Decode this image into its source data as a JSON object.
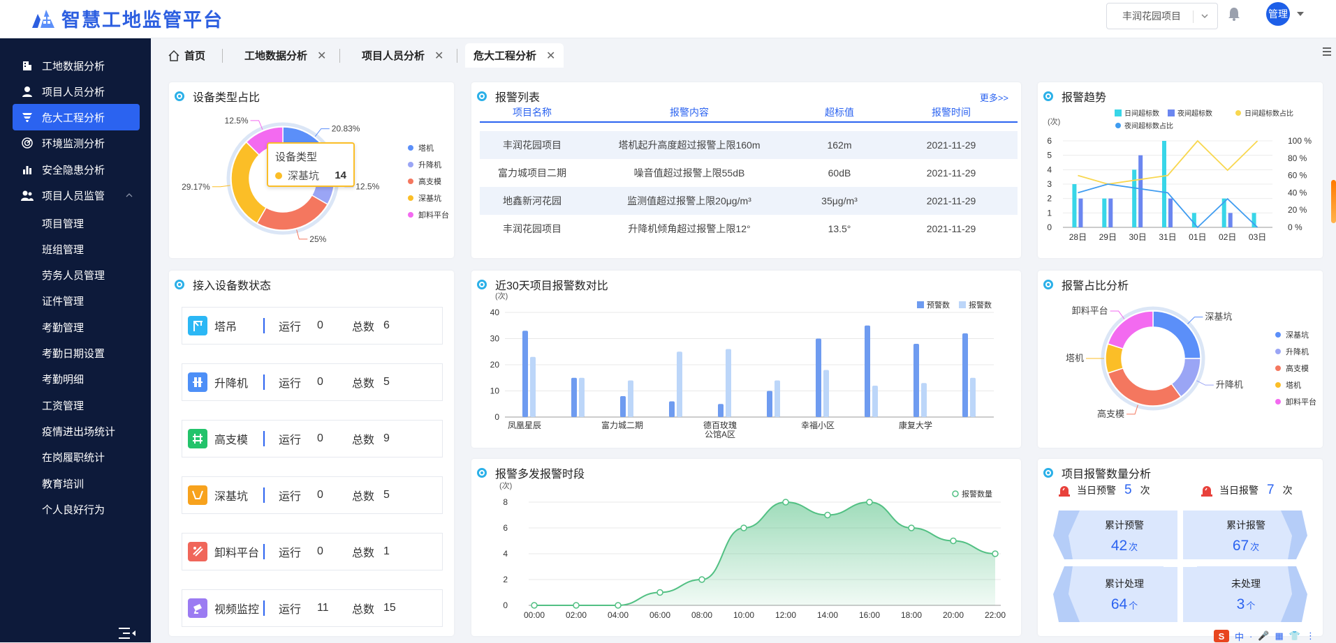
{
  "app": {
    "title": "智慧工地监管平台",
    "project_select": "丰润花园项目",
    "user_avatar": "管理"
  },
  "colors": {
    "accent": "#2b63f0",
    "sidebar_bg": "#0d1a3a",
    "teal": "#2bb0e8"
  },
  "sidebar": {
    "items": [
      {
        "label": "工地数据分析",
        "icon": "building-icon"
      },
      {
        "label": "项目人员分析",
        "icon": "user-icon"
      },
      {
        "label": "危大工程分析",
        "icon": "filter-icon",
        "active": true
      },
      {
        "label": "环境监测分析",
        "icon": "radar-icon"
      },
      {
        "label": "安全隐患分析",
        "icon": "bar-chart-icon"
      },
      {
        "label": "项目人员监管",
        "icon": "users-icon",
        "expanded": true
      }
    ],
    "sub_items": [
      "项目管理",
      "班组管理",
      "劳务人员管理",
      "证件管理",
      "考勤管理",
      "考勤日期设置",
      "考勤明细",
      "工资管理",
      "疫情进出场统计",
      "在岗履职统计",
      "教育培训",
      "个人良好行为"
    ]
  },
  "tabs": [
    {
      "label": "首页",
      "icon": "home-icon"
    },
    {
      "label": "工地数据分析",
      "closable": true
    },
    {
      "label": "项目人员分析",
      "closable": true
    },
    {
      "label": "危大工程分析",
      "closable": true,
      "active": true
    }
  ],
  "device_type": {
    "title": "设备类型占比",
    "tooltip": {
      "title": "设备类型",
      "name": "深基坑",
      "value": "14"
    },
    "labels": [
      "20.83%",
      "12.5%",
      "25%",
      "29.17%",
      "12.5%"
    ],
    "chart_data": {
      "type": "pie",
      "title": "设备类型占比",
      "slices": [
        {
          "name": "塔机",
          "value": 20.83,
          "color": "#5b8ff9"
        },
        {
          "name": "升降机",
          "value": 12.5,
          "color": "#9aa5f5"
        },
        {
          "name": "高支模",
          "value": 25,
          "color": "#f4775f"
        },
        {
          "name": "深基坑",
          "value": 29.17,
          "color": "#fbbe27"
        },
        {
          "name": "卸料平台",
          "value": 12.5,
          "color": "#f36af0"
        }
      ]
    }
  },
  "device_status": {
    "title": "接入设备数状态",
    "run_label": "运行",
    "total_label": "总数",
    "rows": [
      {
        "name": "塔吊",
        "run": "0",
        "total": "6",
        "icon": "crane-icon",
        "color": "#2bb7f5"
      },
      {
        "name": "升降机",
        "run": "0",
        "total": "5",
        "icon": "elevator-icon",
        "color": "#4d8ff7"
      },
      {
        "name": "高支模",
        "run": "0",
        "total": "9",
        "icon": "scaffold-icon",
        "color": "#23c36b"
      },
      {
        "name": "深基坑",
        "run": "0",
        "total": "5",
        "icon": "pit-icon",
        "color": "#f7a21d"
      },
      {
        "name": "卸料平台",
        "run": "0",
        "total": "1",
        "icon": "platform-icon",
        "color": "#f0665a"
      },
      {
        "name": "视频监控",
        "run": "11",
        "total": "15",
        "icon": "camera-icon",
        "color": "#9b7bf2"
      }
    ]
  },
  "alarm_list": {
    "title": "报警列表",
    "more": "更多>>",
    "headers": [
      "项目名称",
      "报警内容",
      "超标值",
      "报警时间"
    ],
    "rows": [
      [
        "丰润花园项目",
        "塔机起升高度超过报警上限160m",
        "162m",
        "2021-11-29"
      ],
      [
        "富力城项目二期",
        "噪音值超过报警上限55dB",
        "60dB",
        "2021-11-29"
      ],
      [
        "地鑫新河花园",
        "监测值超过报警上限20μg/m³",
        "35μg/m³",
        "2021-11-29"
      ],
      [
        "丰润花园项目",
        "升降机倾角超过报警上限12°",
        "13.5°",
        "2021-11-29"
      ]
    ]
  },
  "alarm_trend": {
    "title": "报警趋势",
    "unit": "(次)",
    "chart_data": {
      "type": "bar",
      "title": "报警趋势",
      "categories": [
        "28日",
        "29日",
        "30日",
        "31日",
        "01日",
        "02日",
        "03日"
      ],
      "ylim": [
        0,
        6
      ],
      "y2lim": [
        0,
        100
      ],
      "yticks": [
        "6",
        "5",
        "4",
        "3",
        "2",
        "1",
        "0"
      ],
      "y2ticks": [
        "100 %",
        "80 %",
        "60 %",
        "40 %",
        "20 %",
        "0 %"
      ],
      "legend": [
        "日间超标数",
        "夜间超标数",
        "日间超标数占比",
        "夜间超标数占比"
      ],
      "series": [
        {
          "name": "日间超标数",
          "values": [
            3,
            2,
            4,
            6,
            1,
            2,
            1
          ],
          "color": "#38d6e8"
        },
        {
          "name": "夜间超标数",
          "values": [
            2,
            2,
            5,
            2,
            0,
            1,
            0
          ],
          "color": "#6b86f0"
        },
        {
          "name": "日间超标数占比",
          "values": [
            60,
            50,
            55,
            60,
            100,
            66,
            100
          ],
          "color": "#f8d74f",
          "axis": "right"
        },
        {
          "name": "夜间超标数占比",
          "values": [
            40,
            50,
            45,
            40,
            0,
            33,
            0
          ],
          "color": "#3f9cf0",
          "axis": "right"
        }
      ]
    }
  },
  "compare30": {
    "title": "近30天项目报警数对比",
    "unit": "(次)",
    "chart_data": {
      "type": "bar",
      "title": "近30天项目报警数对比",
      "categories": [
        "凤凰星辰",
        "",
        "富力城二期",
        "",
        "德百玫瑰公馆A区",
        "",
        "幸福小区",
        "",
        "康复大学",
        ""
      ],
      "category_labels": [
        "凤凰星辰",
        "富力城二期",
        "德百玫瑰公馆A区",
        "幸福小区",
        "康复大学"
      ],
      "ylim": [
        0,
        40
      ],
      "yticks": [
        "40",
        "30",
        "20",
        "10",
        "0"
      ],
      "series": [
        {
          "name": "预警数",
          "values": [
            33,
            15,
            8,
            6,
            5,
            10,
            30,
            35,
            28,
            32
          ],
          "color": "#6e9bf0"
        },
        {
          "name": "报警数",
          "values": [
            23,
            15,
            14,
            25,
            26,
            14,
            18,
            12,
            13,
            15
          ],
          "color": "#bcd6f9"
        }
      ]
    }
  },
  "hourly": {
    "title": "报警多发报警时段",
    "unit": "(次)",
    "chart_data": {
      "type": "area",
      "title": "报警多发报警时段",
      "x": [
        "00:00",
        "02:00",
        "04:00",
        "06:00",
        "08:00",
        "10:00",
        "12:00",
        "14:00",
        "16:00",
        "18:00",
        "20:00",
        "22:00"
      ],
      "ylim": [
        0,
        8
      ],
      "yticks": [
        "8",
        "6",
        "4",
        "2",
        "0"
      ],
      "series": [
        {
          "name": "报警数量",
          "values": [
            0,
            0,
            0,
            1,
            2,
            6,
            8,
            7,
            8,
            6,
            5,
            4
          ],
          "color": "#52c083"
        }
      ]
    }
  },
  "ratio": {
    "title": "报警占比分析",
    "chart_data": {
      "type": "pie",
      "title": "报警占比分析",
      "slices": [
        {
          "name": "深基坑",
          "value": 25,
          "color": "#5b8ff9"
        },
        {
          "name": "升降机",
          "value": 15,
          "color": "#9aa5f5"
        },
        {
          "name": "高支模",
          "value": 30,
          "color": "#f4775f"
        },
        {
          "name": "塔机",
          "value": 10,
          "color": "#fbbe27"
        },
        {
          "name": "卸料平台",
          "value": 20,
          "color": "#f36af0"
        }
      ]
    }
  },
  "count": {
    "title": "项目报警数量分析",
    "today_warn_label": "当日预警",
    "today_warn": "5",
    "today_alarm_label": "当日报警",
    "today_alarm": "7",
    "unit_ci": "次",
    "unit_ge": "个",
    "boxes": [
      {
        "label": "累计预警",
        "value": "42",
        "unit": "次"
      },
      {
        "label": "累计报警",
        "value": "67",
        "unit": "次"
      },
      {
        "label": "累计处理",
        "value": "64",
        "unit": "个"
      },
      {
        "label": "未处理",
        "value": "3",
        "unit": "个"
      }
    ]
  },
  "ime": {
    "s": "S",
    "items": [
      "中",
      "·",
      "🎤",
      "▦",
      "👕",
      "⋮"
    ]
  }
}
